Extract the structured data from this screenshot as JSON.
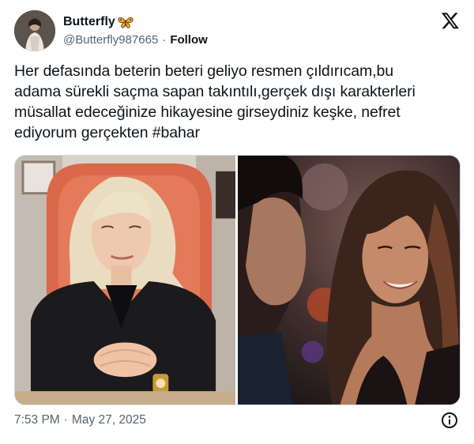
{
  "author": {
    "display_name": "Butterfly",
    "badge_icon": "butterfly-emoji-icon",
    "handle": "@Butterfly987665",
    "separator": "·",
    "follow_label": "Follow"
  },
  "platform_icon": "x-logo-icon",
  "tweet": {
    "text": "Her defasında beterin beteri geliyo resmen çıldırıcam,bu\nadama sürekli saçma sapan takıntılı,gerçek dışı karakterleri\nmüsallat edeceğinize hikayesine girseydiniz keşke, nefret\nediyorum gerçekten ",
    "hashtag": "#bahar"
  },
  "media": [
    {
      "name": "photo-left",
      "subject": "blonde woman in black blazer at desk"
    },
    {
      "name": "photo-right",
      "subject": "smiling woman with long brown hair facing man"
    }
  ],
  "footer": {
    "time": "7:53 PM",
    "separator": "·",
    "date": "May 27, 2025",
    "info_icon": "info-icon"
  },
  "colors": {
    "text_primary": "#0f1419",
    "text_secondary": "#536471",
    "border": "#cfd9de",
    "background": "#ffffff"
  }
}
